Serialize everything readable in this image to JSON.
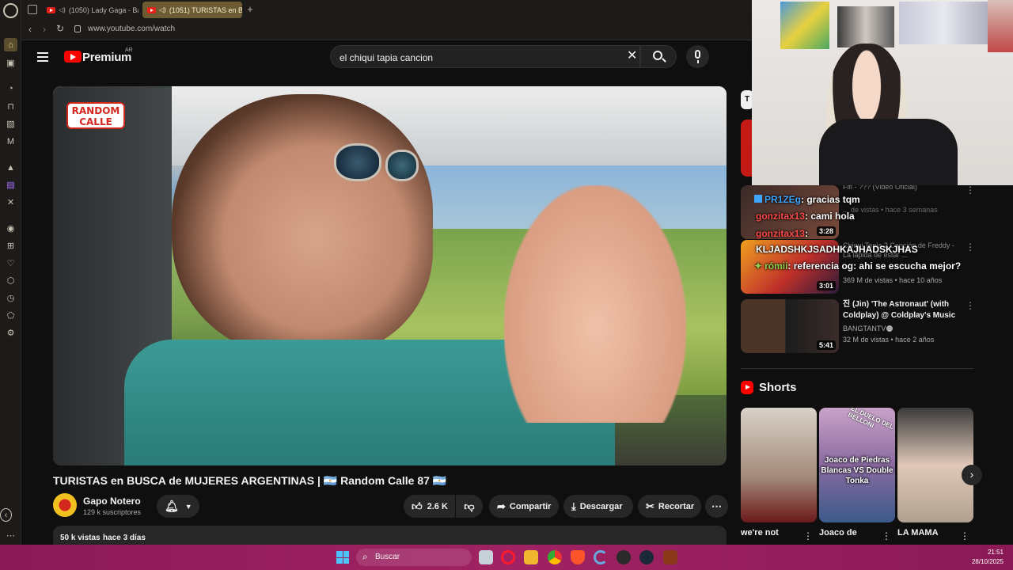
{
  "browser": {
    "tabs": [
      {
        "label": "(1050) Lady Gaga - Ba"
      },
      {
        "label": "(1051) TURISTAS en B"
      }
    ],
    "url": "www.youtube.com/watch"
  },
  "youtube": {
    "logo": "Premium",
    "region": "AR",
    "search_value": "el chiqui tapia cancion"
  },
  "video": {
    "badge_line1": "RANDOM",
    "badge_line2": "CALLE",
    "title": "TURISTAS en BUSCA de MUJERES ARGENTINAS | 🇦🇷 Random Calle 87 🇦🇷",
    "channel": "Gapo Notero",
    "subscribers": "129 k suscriptores",
    "likes": "2.6 K",
    "share": "Compartir",
    "download": "Descargar",
    "clip": "Recortar",
    "views": "50 k vistas",
    "age": "hace 3 días"
  },
  "related": {
    "tag": "T",
    "item1_title": "Fifi - ??? (Video Oficial)",
    "item1_meta": "... de vistas • hace 3 semanas",
    "item1_duration": "3:28",
    "item2_title": "Chiqui Tapia 2 Canción de Freddy - La lápida de estar ...",
    "item2_meta": "369 M de vistas • hace 10 años",
    "item2_duration": "3:01",
    "item3_title": "진 (Jin) 'The Astronaut' (with Coldplay) @ Coldplay's Music ...",
    "item3_channel": "BANGTANTV",
    "item3_meta": "32 M de vistas • hace 2 años",
    "item3_duration": "5:41"
  },
  "chat": [
    {
      "user": "PR1ZEg",
      "text": ": gracias tqm",
      "color": "#3ea6ff"
    },
    {
      "user": "gonzitax13",
      "text": ": cami hola",
      "color": "#ff4b4b"
    },
    {
      "user": "gonzitax13",
      "text": ":",
      "color": "#ff4b4b"
    },
    {
      "user": "",
      "text": "KLJADSHKJSADHKAJHADSKJHAS",
      "color": "#ffffff"
    },
    {
      "user": "rómii",
      "text": ": referencia og: ahi se escucha mejor?",
      "color": "#8fd14f"
    }
  ],
  "shorts": {
    "heading": "Shorts",
    "items": [
      {
        "title": "we're not",
        "overlay": ""
      },
      {
        "title": "Joaco de",
        "overlay": "Joaco de Piedras Blancas VS Double Tonka",
        "banner": "EL DUELO DEL BELLONI"
      },
      {
        "title": "LA MAMA",
        "overlay": ""
      }
    ]
  },
  "taskbar": {
    "search_placeholder": "Buscar",
    "time": "21:51",
    "date": "28/10/2025"
  },
  "colors": {
    "accent": "#a02263",
    "youtube_red": "#ff0000",
    "opera_tab": "#6d5c33"
  }
}
